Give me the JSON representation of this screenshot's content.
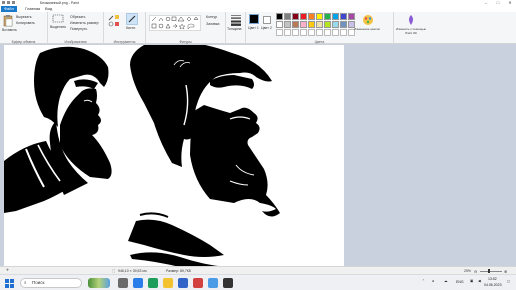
{
  "window": {
    "title": "Безымянный.png - Paint"
  },
  "tabs": {
    "file": "Файл",
    "home": "Главная",
    "view": "Вид"
  },
  "clipboard": {
    "paste": "Вставить",
    "cut": "Вырезать",
    "copy": "Копировать",
    "label": "Буфер обмена"
  },
  "image": {
    "select": "Выделить",
    "crop": "Обрезать",
    "resize": "Изменить размер",
    "rotate": "Повернуть",
    "label": "Изображения"
  },
  "tools": {
    "brushes": "Кисти",
    "label": "Инструменты"
  },
  "shapes": {
    "outline": "Контур",
    "fill": "Заливка",
    "label": "Фигуры"
  },
  "size": {
    "label": "Толщина"
  },
  "colors": {
    "color1": "Цвет 1",
    "color2": "Цвет 2",
    "edit": "Изменение цветов",
    "label": "Цвета",
    "swatches": [
      "#000000",
      "#7f7f7f",
      "#880015",
      "#ed1c24",
      "#ff7f27",
      "#fff200",
      "#22b14c",
      "#00a2e8",
      "#3f48cc",
      "#a349a4",
      "#ffffff",
      "#c3c3c3",
      "#b97a57",
      "#ffaec9",
      "#ffc90e",
      "#efe4b0",
      "#b5e61d",
      "#99d9ea",
      "#7092be",
      "#c8bfe7"
    ]
  },
  "paint3d": {
    "label": "Изменить с помощью Paint 3D"
  },
  "status": {
    "dimensions": "946,10 × 39,53 см",
    "filesize": "Размер: 89,7КБ",
    "zoom": "25%"
  },
  "taskbar": {
    "search": "Поиск",
    "lang": "ENG",
    "time": "13:52",
    "date": "04.06.2023"
  }
}
